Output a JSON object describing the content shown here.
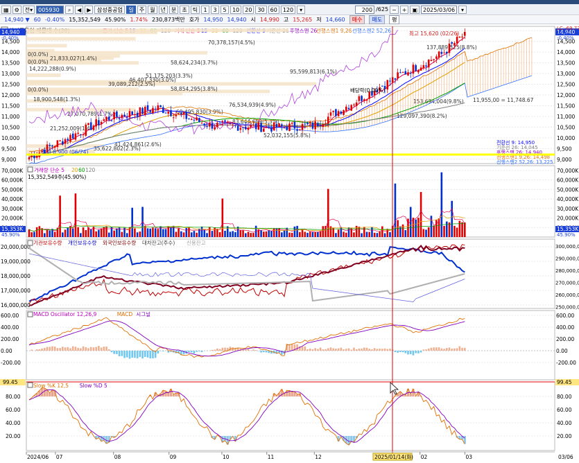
{
  "toolbar": {
    "stock_code": "005930",
    "stock_name": "삼성중공업",
    "period_buttons": [
      "일",
      "주",
      "월",
      "년",
      "분",
      "초",
      "틱"
    ],
    "minute_buttons": [
      "1",
      "3",
      "5",
      "10",
      "20",
      "30",
      "60",
      "120"
    ],
    "count_value": "200",
    "count_total": "/625",
    "date_value": "2025/03/06"
  },
  "quote": {
    "price": "14,940",
    "change": "60",
    "change_pct": "-0.40%",
    "volume": "15,352,549",
    "vol_ratio": "45.90%",
    "vol_change": "1.74%",
    "amount": "230,873백만",
    "ask_label": "호가",
    "ask": "14,950",
    "bid": "14,940",
    "open_label": "시",
    "open": "14,990",
    "high_label": "고",
    "high": "15,265",
    "low_label": "저",
    "low": "14,660",
    "buy_label": "매수",
    "sell_label": "매도",
    "eval_label": "평"
  },
  "main_panel": {
    "title": "삼성중공업 매물대 수(30)",
    "legend": [
      {
        "text": "종가 단순 5",
        "color": "#e0004a"
      },
      {
        "text": "15",
        "color": "#0000ff"
      },
      {
        "text": "33",
        "color": "#e0a000"
      },
      {
        "text": "60",
        "color": "#00a000"
      },
      {
        "text": "120",
        "color": "#808080"
      },
      {
        "text": "거래 단순 5",
        "color": "#e0004a"
      },
      {
        "text": "15",
        "color": "#0000ff"
      },
      {
        "text": "33",
        "color": "#e0a000"
      },
      {
        "text": "60",
        "color": "#00a000"
      },
      {
        "text": "120",
        "color": "#808080"
      },
      {
        "text": "전환선 9",
        "color": "#0000ff"
      },
      {
        "text": "기준선 26",
        "color": "#808080"
      },
      {
        "text": "후행스팬 26",
        "color": "#9000c0"
      },
      {
        "text": "선행스팬1 9,26",
        "color": "#e07000"
      },
      {
        "text": "선행스팬2 52,26",
        "color": "#3070ff"
      }
    ],
    "ylabels": [
      "15,000",
      "14,500",
      "14,000",
      "13,500",
      "13,000",
      "12,500",
      "12,000",
      "11,500",
      "11,000",
      "10,500",
      "10,000",
      "9,500",
      "9,000"
    ],
    "right_ylabels": [
      "14,500",
      "14,000",
      "13,500",
      "13,000",
      "12,500",
      "12,000",
      "11,500",
      "11,000",
      "10,500",
      "10,000",
      "9,500",
      "9,000"
    ],
    "price_tag": "14,940",
    "price_tag_pct": "-0.40%",
    "lc_label": "LC:-69.77",
    "hc_label": "HC:+4.35",
    "volume_profile": [
      "70,378,157(4.5%)",
      "58,624,234(3.7%)",
      "95,599,813(6.1%)",
      "51,175,203(3.3%)",
      "46,407,330(3.0%)",
      "39,089,212(2.5%)",
      "58,854,295(3.8%)",
      "76,534,939(4.9%)",
      "60,495,830(3.9%)",
      "27,070,789(1.7%)",
      "21,833,027(1.4%)",
      "14,222,288(0.9%)",
      "18,900,548(1.3%)",
      "21,252,009(1.4%)",
      "129,097,390(8.2%)",
      "153,694,004(9.8%)",
      "137,889,525(8.8%)",
      "83,644,659(5.3%)",
      "35,622,802(2.3%)",
      "41,424,861(2.6%)",
      "52,032,155(5.8%)"
    ],
    "zero_labels": [
      "0(0.0%)",
      "0(0.0%)",
      "0(0.0%)",
      "0(0.0%)"
    ],
    "high_label": "최고 15,620 (02/26)",
    "low_label": "최저 8,900 (06/24)",
    "dividend_label": "배당락(0.00%)",
    "ichimoku_gap": "11,955,00 = 11,748.67",
    "ichimoku_values": [
      {
        "text": "전환선 9: 14,950",
        "color": "#0000ff"
      },
      {
        "text": "기준선 26: 14,045",
        "color": "#808080"
      },
      {
        "text": "후행스팬 26: 14,940",
        "color": "#9000c0"
      },
      {
        "text": "선행스팬1 9,26: 14,498",
        "color": "#e07000"
      },
      {
        "text": "선행스팬2 52,26: 13,225",
        "color": "#3070ff"
      }
    ]
  },
  "volume_panel": {
    "legend_title": "거래량 단순 5",
    "legend_nums": [
      "20",
      "60",
      "120"
    ],
    "current": "15,352,549주(45.90%)",
    "ylabels": [
      "70,000K",
      "60,000K",
      "50,000K",
      "40,000K",
      "30,000K",
      "20,000K",
      "10,000K"
    ],
    "tag": "15,353K",
    "tag_pct": "45.90%"
  },
  "holders_panel": {
    "legend": [
      {
        "text": "기관보유수량",
        "color": "#c00000"
      },
      {
        "text": "개인보유수량",
        "color": "#0000c0"
      },
      {
        "text": "외국인보유수량",
        "color": "#800000"
      },
      {
        "text": "대차잔고(주수)",
        "color": "#404040"
      },
      {
        "text": "신용잔고",
        "color": "#a0a0a0"
      }
    ],
    "ylabels": [
      "20,000,000",
      "19,000,000",
      "18,000,000",
      "17,000,000",
      "16,000,000"
    ],
    "right_ylabels": [
      "300,000,000",
      "290,000,000",
      "280,000,000",
      "270,000,000",
      "260,000,000",
      "250,000,000"
    ]
  },
  "macd_panel": {
    "legend": [
      {
        "text": "MACD Oscillator 12,26,9",
        "color": "#c000c0"
      },
      {
        "text": "MACD",
        "color": "#e07000"
      },
      {
        "text": "시그널",
        "color": "#8000c0"
      }
    ],
    "ylabels": [
      "600.00",
      "400.00",
      "200.00",
      "0.00",
      "-200.00"
    ]
  },
  "stoch_panel": {
    "tag": "99.45",
    "legend": [
      {
        "text": "Slow %K 12,5",
        "color": "#e07000"
      },
      {
        "text": "Slow %D 5",
        "color": "#8000c0"
      }
    ],
    "ylabels": [
      "80.00",
      "60.00",
      "40.00",
      "20.00"
    ]
  },
  "xaxis": {
    "labels": [
      "2024/06",
      "07",
      "08",
      "09",
      "10",
      "11",
      "12",
      "02",
      "03"
    ],
    "cursor_date": "2025/01/14(화)",
    "right_label": "03/06"
  }
}
